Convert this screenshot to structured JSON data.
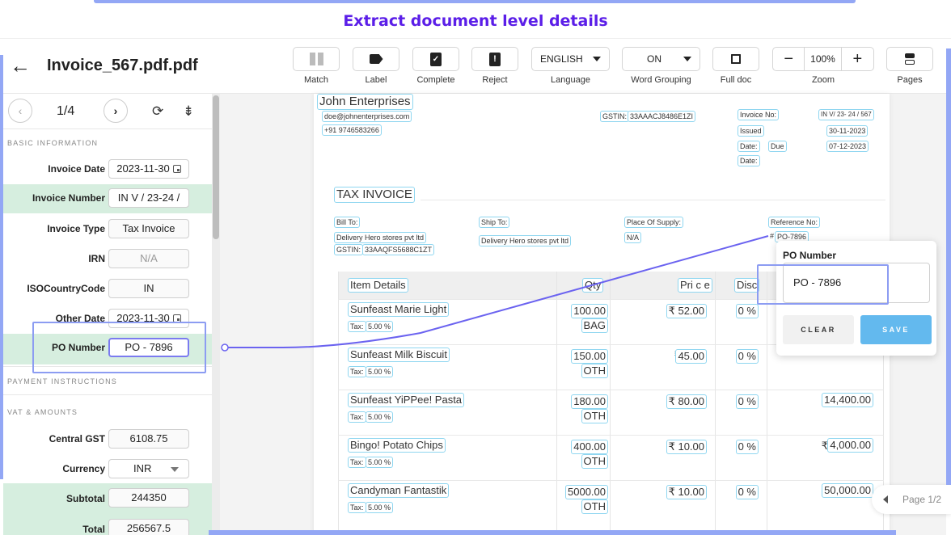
{
  "banner": {
    "title": "Extract document level details"
  },
  "header": {
    "back_icon": "arrow-left-icon",
    "doc_title": "Invoice_567.pdf.pdf",
    "tools": {
      "match": "Match",
      "label": "Label",
      "complete": "Complete",
      "reject": "Reject",
      "language_value": "ENGLISH",
      "language_label": "Language",
      "word_grouping_value": "ON",
      "word_grouping_label": "Word Grouping",
      "full_doc": "Full doc",
      "zoom_value": "100%",
      "zoom_minus": "−",
      "zoom_plus": "+",
      "zoom_label": "Zoom",
      "pages": "Pages"
    }
  },
  "sidebar": {
    "pager": {
      "prev": "‹",
      "next": "›",
      "text": "1/4",
      "sync_icon": "⟳",
      "filter_icon": "⇟"
    },
    "sections": {
      "basic": "BASIC INFORMATION",
      "payment": "PAYMENT INSTRUCTIONS",
      "vat": "VAT & AMOUNTS"
    },
    "fields": [
      {
        "label": "Invoice Date",
        "value": "2023-11-30"
      },
      {
        "label": "Invoice Number",
        "value": "IN V / 23-24 /"
      },
      {
        "label": "Invoice Type",
        "value": "Tax Invoice"
      },
      {
        "label": "IRN",
        "value": "N/A"
      },
      {
        "label": "ISOCountryCode",
        "value": "IN"
      },
      {
        "label": "Other Date",
        "value": "2023-11-30"
      },
      {
        "label": "PO Number",
        "value": "PO - 7896"
      },
      {
        "label": "Central GST",
        "value": "6108.75"
      },
      {
        "label": "Currency",
        "value": "INR"
      },
      {
        "label": "Subtotal",
        "value": "244350"
      },
      {
        "label": "Total",
        "value": "256567.5"
      }
    ]
  },
  "document": {
    "company": "John Enterprises",
    "email": "doe@johnenterprises.com",
    "phone": "+91 9746583266",
    "gstin_label": "GSTIN:",
    "gstin": "33AAACJ8486E1ZI",
    "invoice_no_label": "Invoice No:",
    "invoice_no": "IN V/ 23- 24 / 567",
    "issued_label": "Issued",
    "issued_date": "30-11-2023",
    "date_label_1": "Date:",
    "due_label": "Due",
    "due_date": "07-12-2023",
    "date_label_2": "Date:",
    "title": "TAX INVOICE",
    "bill_to_label": "Bill To:",
    "bill_to": "Delivery Hero stores pvt ltd",
    "bill_gstin_label": "GSTIN:",
    "bill_gstin": "33AAQFS5688C1ZT",
    "ship_to_label": "Ship To:",
    "ship_to": "Delivery Hero stores pvt ltd",
    "place_label": "Place Of Supply:",
    "place": "N/A",
    "ref_label": "Reference No:",
    "ref_hash": "#",
    "ref_value": "PO-7896",
    "table": {
      "headers": {
        "item": "Item Details",
        "qty": "Qty",
        "price": "Pri c e",
        "disc": "Disc"
      },
      "tax_label": "Tax:",
      "rows": [
        {
          "item": "Sunfeast Marie Light",
          "tax": "5.00 %",
          "qty": "100.00",
          "unit": "BAG",
          "price": "₹ 52.00",
          "disc": "0 %",
          "amount": ""
        },
        {
          "item": "Sunfeast Milk Biscuit",
          "tax": "5.00 %",
          "qty": "150.00",
          "unit": "OTH",
          "price_sym": "₹",
          "price": "45.00",
          "disc": "0 %",
          "amount": ""
        },
        {
          "item": "Sunfeast YiPPee! Pasta",
          "tax": "5.00 %",
          "qty": "180.00",
          "unit": "OTH",
          "price": "₹ 80.00",
          "disc": "0 %",
          "amount_sym": "₹",
          "amount": "14,400.00"
        },
        {
          "item": "Bingo! Potato Chips",
          "tax": "5.00 %",
          "qty": "400.00",
          "unit": "OTH",
          "price": "₹ 10.00",
          "disc": "0 %",
          "amount_sym": "₹",
          "amount": "4,000.00"
        },
        {
          "item": "Candyman Fantastik",
          "tax": "5.00 %",
          "qty": "5000.00",
          "unit": "OTH",
          "price": "₹ 10.00",
          "disc": "0 %",
          "amount_sym": "₹",
          "amount": "50,000.00"
        }
      ]
    }
  },
  "popup": {
    "title": "PO Number",
    "value": "PO - 7896",
    "clear": "CLEAR",
    "save": "SAVE"
  },
  "page_nav": {
    "text": "Page 1/2"
  },
  "colors": {
    "accent": "#5b1ee8",
    "highlight_row": "#d6eedf",
    "outline": "#93a7f5",
    "save": "#63b9ee",
    "connector": "#6b63f0"
  }
}
